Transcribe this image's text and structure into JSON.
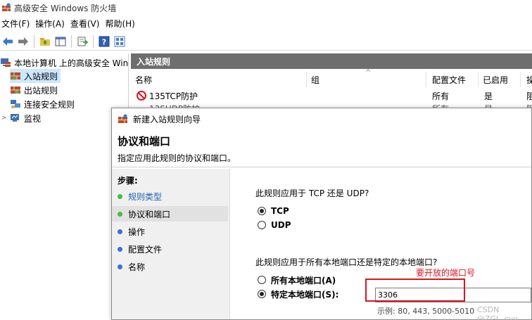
{
  "window": {
    "title": "高级安全 Windows 防火墙"
  },
  "menu": {
    "items": [
      "文件(F)",
      "操作(A)",
      "查看(V)",
      "帮助(H)"
    ]
  },
  "toolbar": {
    "icons": [
      "back-arrow-icon",
      "forward-arrow-icon",
      "folder-up-icon",
      "show-hide-tree-icon",
      "export-icon",
      "help-icon",
      "properties-icon"
    ]
  },
  "tree": {
    "root_label": "本地计算机 上的高级安全 Windows 防火墙",
    "inbound_label": "入站规则",
    "outbound_label": "出站规则",
    "connection_label": "连接安全规则",
    "monitor_label": "监视",
    "expander": ">"
  },
  "list": {
    "header": "入站规则",
    "columns": [
      "名称",
      "组",
      "配置文件",
      "已启用",
      "操"
    ],
    "sort_indicator": "^",
    "rows": [
      {
        "name": "135TCP防护",
        "group": "",
        "profile": "所有",
        "enabled": "是",
        "action": "阻"
      }
    ],
    "row2_partial": {
      "name": "135UDP防护",
      "profile": "所有",
      "enabled": "是",
      "action": "阻"
    }
  },
  "wizard": {
    "title": "新建入站规则向导",
    "heading": "协议和端口",
    "subtitle": "指定应用此规则的协议和端口。",
    "steps_title": "步骤:",
    "steps": [
      {
        "label": "规则类型",
        "state": "done"
      },
      {
        "label": "协议和端口",
        "state": "current"
      },
      {
        "label": "操作",
        "state": "pending"
      },
      {
        "label": "配置文件",
        "state": "pending"
      },
      {
        "label": "名称",
        "state": "pending"
      }
    ],
    "question_protocol": "此规则应用于 TCP 还是 UDP?",
    "tcp_label": "TCP",
    "udp_label": "UDP",
    "protocol_selected": "TCP",
    "question_ports": "此规则应用于所有本地端口还是特定的本地端口?",
    "all_ports_label": "所有本地端口(A)",
    "specific_ports_label": "特定本地端口(S):",
    "ports_selected": "specific",
    "port_value": "3306",
    "example_text": "示例: 80, 443, 5000-5010",
    "annotation_text": "要开放的端口号",
    "watermark_text": "CSDN @ZGL_cyy"
  },
  "colors": {
    "accent_red": "#d9141e",
    "step_done_blue": "#1a5fb4",
    "step_dot_green": "#3fbf3f",
    "step_dot_blue": "#3b6fd4",
    "list_header_gray": "#6e6e6e",
    "selection_blue": "#cce8ff"
  }
}
